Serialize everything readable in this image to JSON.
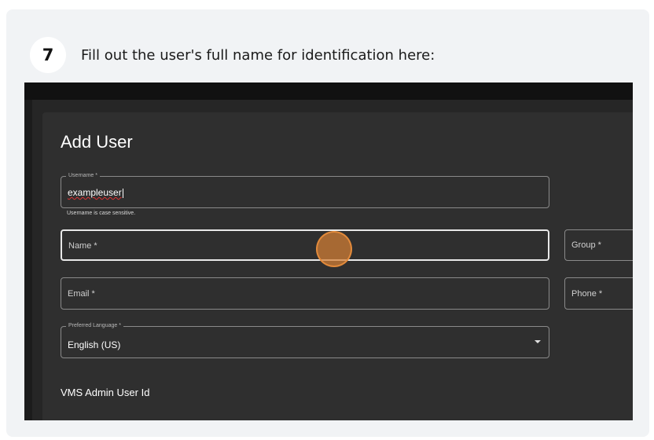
{
  "step": {
    "number": "7",
    "instruction": "Fill out the user's full name for identification here:"
  },
  "form": {
    "title": "Add User",
    "username": {
      "label": "Username *",
      "value": "exampleuser",
      "helper": "Username is case sensitive."
    },
    "name": {
      "placeholder": "Name *"
    },
    "group": {
      "placeholder": "Group *"
    },
    "email": {
      "placeholder": "Email *"
    },
    "phone": {
      "placeholder": "Phone *"
    },
    "language": {
      "label": "Preferred Language *",
      "value": "English (US)"
    },
    "vms_section": "VMS Admin User Id"
  },
  "colors": {
    "card_bg": "#f1f3f5",
    "app_bg": "#2f2f2f",
    "click_marker": "#d68034"
  }
}
